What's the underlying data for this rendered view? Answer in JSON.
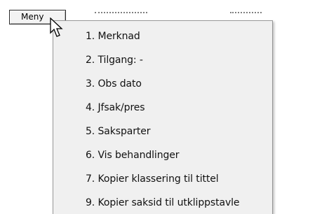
{
  "toolbar": {
    "menu_button_label": "Meny"
  },
  "context_menu": {
    "items": [
      {
        "label": "1. Merknad"
      },
      {
        "label": "2. Tilgang: -"
      },
      {
        "label": "3. Obs dato"
      },
      {
        "label": "4. Jfsak/pres"
      },
      {
        "label": "5. Saksparter"
      },
      {
        "label": "6. Vis behandlinger"
      },
      {
        "label": "7. Kopier klassering til tittel"
      },
      {
        "label": "9. Kopier saksid til utklippstavle"
      }
    ]
  },
  "icons": {
    "cursor": "arrow-pointer-icon"
  },
  "colors": {
    "menu_background": "#f0f0f0",
    "menu_border": "#979797",
    "text": "#111111"
  }
}
